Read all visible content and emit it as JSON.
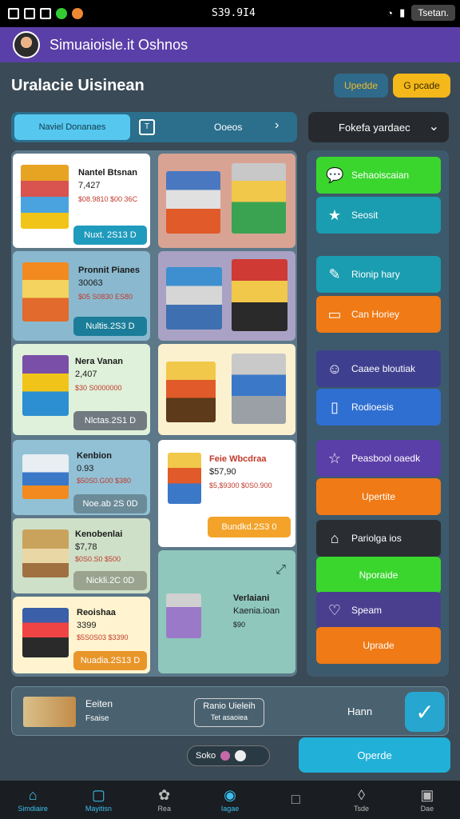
{
  "status_bar": {
    "time": "S39.9I4",
    "label": "Tsetan."
  },
  "app": {
    "title": "Simuaioisle.it Oshnos"
  },
  "header": {
    "title": "Uralacie Uisinean",
    "upgrade_label": "Upedde",
    "gp_label": "G pcade"
  },
  "tabs": {
    "active_label": "Naviel Donanaes",
    "label": "Ooeos"
  },
  "dropdown": {
    "value": "Fokefa yardaec"
  },
  "cards": [
    {
      "name": "Nantel Btsnan",
      "price": "7,427",
      "sub": "$08.9810  $00 36C",
      "button": "Nuxt. 2S13 D"
    },
    {
      "name": "Pronnit Pianes",
      "price": "30063",
      "sub": "$05 S0830 ES80",
      "button": "Nultis.2S3 D"
    },
    {
      "name": "Nera Vanan",
      "price": "2,407",
      "sub": "$30  S0000000",
      "button": "Nlctas.2S1 D"
    },
    {
      "name": "Kenbion",
      "price": "0.93",
      "sub": "$50S0.G00 $380",
      "button": "Noe.ab 2S 0D"
    },
    {
      "name": "Kenobenlai",
      "price": "$7,78",
      "sub": "$0S0.S0 $500",
      "button": "Nickli.2C 0D"
    },
    {
      "name": "Reoishaa",
      "price": "3399",
      "sub": "$5S0S03  $3390",
      "button": "Nuadia.2S13 D"
    },
    {
      "name": "Feie Wbcdraa",
      "price": "$57,90",
      "sub": "$5,$9300  $0S0.900",
      "button": "Bundkd.2S3 0"
    },
    {
      "name": "Verlaiani",
      "price": "Kaenia.ioan",
      "sub": "$90",
      "button": ""
    }
  ],
  "side_menu": [
    {
      "label": "Sehaoiscaian",
      "icon": "chat-icon",
      "color": "#3ad62e"
    },
    {
      "label": "Seosit",
      "icon": "star-icon",
      "color": "#1a9db0"
    },
    {
      "label": "Rionip hary",
      "icon": "puzzle-icon",
      "color": "#1a9db0"
    },
    {
      "label": "Can Horiey",
      "icon": "bag-icon",
      "color": "#f07a15"
    },
    {
      "label": "Caaee bloutiak",
      "icon": "user-icon",
      "color": "#3e3f8f"
    },
    {
      "label": "Rodioesis",
      "icon": "doc-icon",
      "color": "#2f6fd1"
    },
    {
      "label": "Peasbool oaedk",
      "icon": "star-outline-icon",
      "color": "#5b3fa8"
    },
    {
      "label": "Upertite",
      "icon": "",
      "color": "#f07a15"
    },
    {
      "label": "Pariolga ios",
      "icon": "shop-icon",
      "color": "#2a2e33"
    },
    {
      "label": "Nporaide",
      "icon": "",
      "color": "#3ad62e"
    },
    {
      "label": "Speam",
      "icon": "heart-icon",
      "color": "#4a3f8f"
    },
    {
      "label": "Uprade",
      "icon": "",
      "color": "#f07a15"
    }
  ],
  "bottom_bar": {
    "label1": "Eeiten",
    "label2": "Fsaise",
    "box_line1": "Ranio Uieleih",
    "box_line2": "Tet asaoiea",
    "name": "Hann"
  },
  "pager": {
    "label": "Soko"
  },
  "operate_label": "Operde",
  "nav": [
    {
      "label": "Simdiaire",
      "icon": "home-icon",
      "active": true
    },
    {
      "label": "Mayitisn",
      "icon": "tablet-icon",
      "active": true
    },
    {
      "label": "Rea",
      "icon": "gear-icon",
      "active": false
    },
    {
      "label": "Iagae",
      "icon": "circle-icon",
      "active": true
    },
    {
      "label": "",
      "icon": "square-icon",
      "active": false
    },
    {
      "label": "Tsde",
      "icon": "drop-icon",
      "active": false
    },
    {
      "label": "Dae",
      "icon": "box-icon",
      "active": false
    }
  ]
}
